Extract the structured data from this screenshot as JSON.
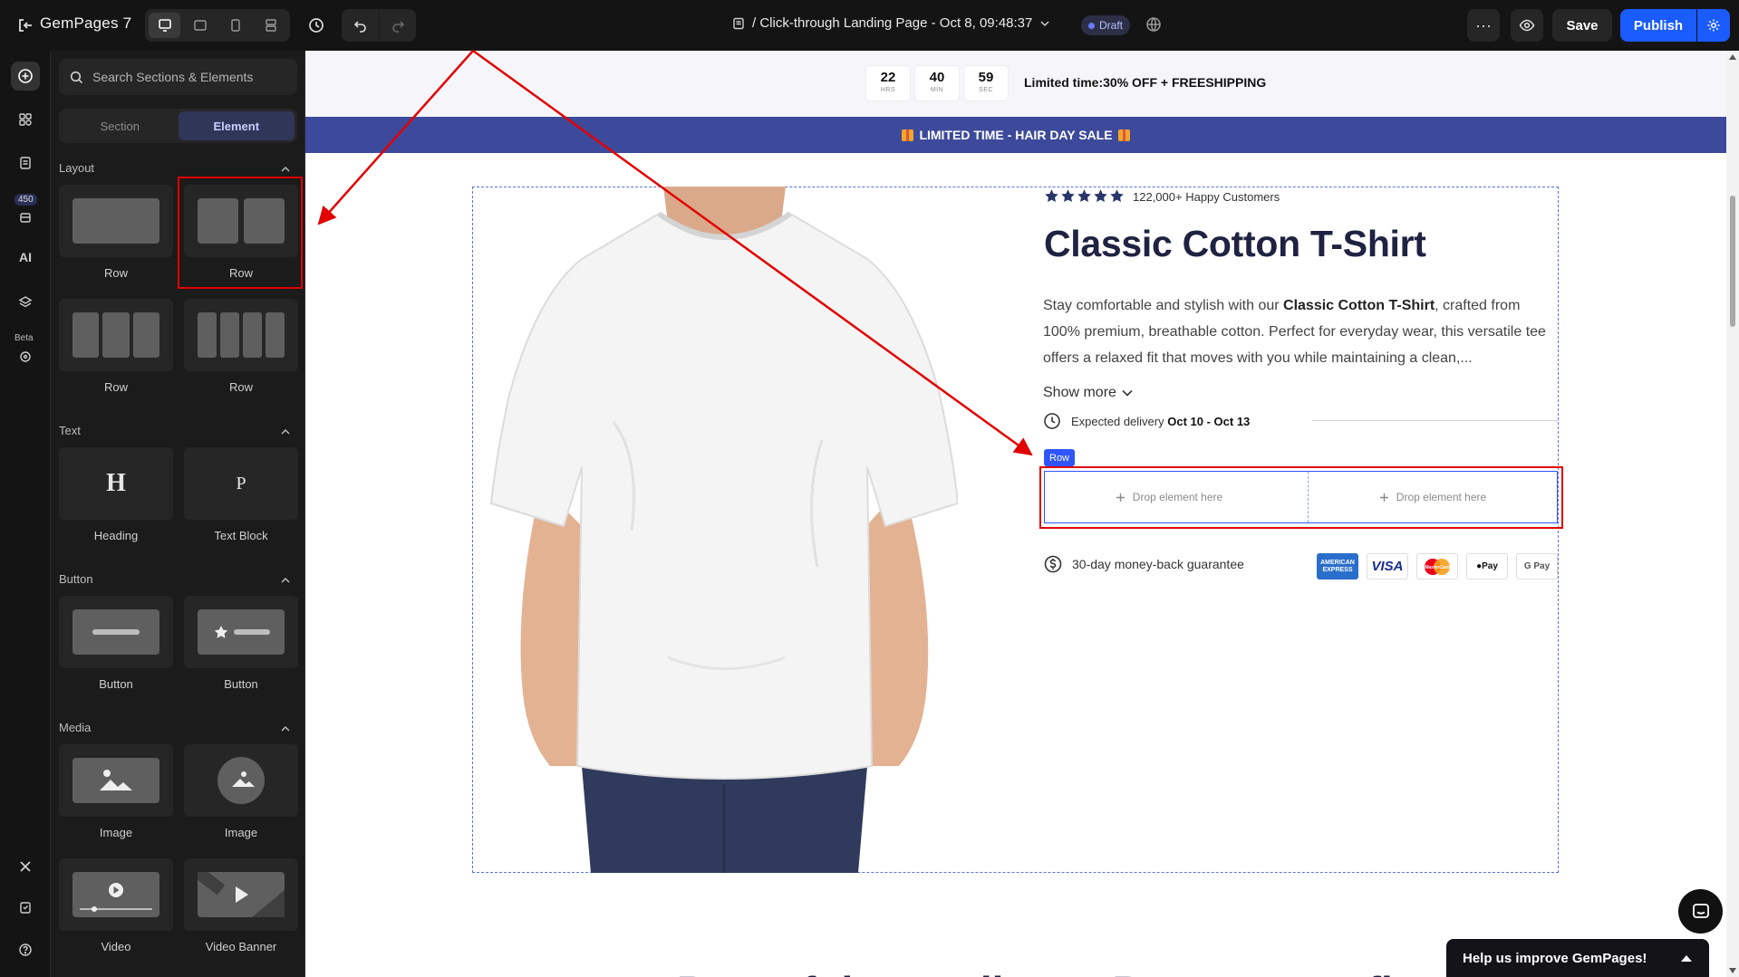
{
  "topbar": {
    "brand": "GemPages 7",
    "page_title": "/ Click-through Landing Page - Oct 8, 09:48:37",
    "status": "Draft",
    "save_label": "Save",
    "publish_label": "Publish"
  },
  "rail": {
    "badge_count": "450",
    "ai_label": "AI",
    "beta_label": "Beta"
  },
  "panel": {
    "search_placeholder": "Search Sections & Elements",
    "tabs": {
      "section": "Section",
      "element": "Element"
    },
    "categories": {
      "layout": "Layout",
      "text": "Text",
      "button": "Button",
      "media": "Media"
    },
    "layout_items": [
      "Row",
      "Row",
      "Row",
      "Row"
    ],
    "text_items": [
      {
        "label": "Heading",
        "glyph": "H"
      },
      {
        "label": "Text Block",
        "glyph": "P"
      }
    ],
    "button_items": [
      "Button",
      "Button"
    ],
    "media_items": [
      "Image",
      "Image",
      "Video",
      "Video Banner"
    ]
  },
  "canvas": {
    "countdown": {
      "hours": "22",
      "hours_unit": "HRS",
      "minutes": "40",
      "minutes_unit": "MIN",
      "seconds": "59",
      "seconds_unit": "SEC",
      "text": "Limited time:30% OFF + FREESHIPPING"
    },
    "sale_banner": "LIMITED TIME - HAIR DAY SALE",
    "product": {
      "rating_stars": 5,
      "happy_customers": "122,000+ Happy Customers",
      "title": "Classic Cotton T-Shirt",
      "desc_before": "Stay comfortable and stylish with our ",
      "desc_bold": "Classic Cotton T-Shirt",
      "desc_after": ", crafted from 100% premium, breathable cotton. Perfect for everyday wear, this versatile tee offers a relaxed fit that moves with you while maintaining a clean,...",
      "show_more": "Show more",
      "delivery_label": "Expected delivery",
      "delivery_dates": "Oct 10 - Oct 13",
      "row_tag": "Row",
      "drop_left": "Drop element here",
      "drop_right": "Drop element here",
      "guarantee": "30-day money-back guarantee",
      "payments": {
        "amex": "AMERICAN EXPRESS",
        "visa": "VISA",
        "mastercard": "MasterCard",
        "applepay": "Pay",
        "googlepay": "G Pay"
      }
    },
    "bottom_heading": "Powerful Ingredients, Proven Benefits"
  },
  "help": {
    "label": "Help us improve GemPages!"
  },
  "colors": {
    "accent": "#1a5cff",
    "banner": "#3d4a9b",
    "annotation": "#e20000",
    "title": "#1f2241"
  }
}
